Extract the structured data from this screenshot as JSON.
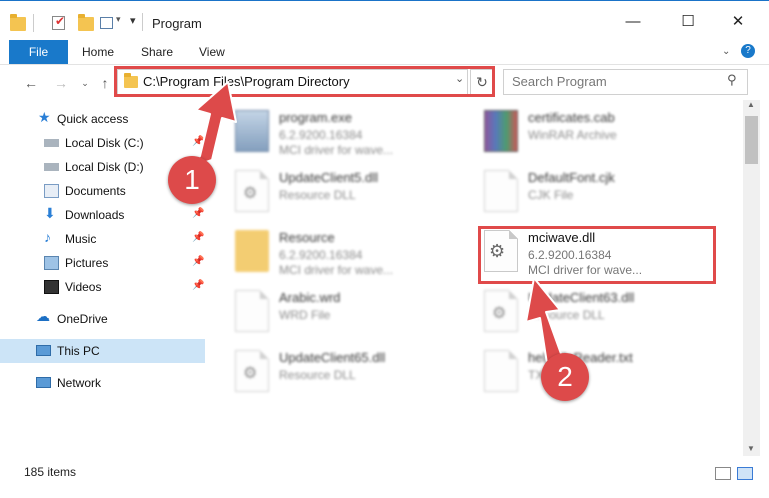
{
  "window": {
    "title": "Program",
    "minimize": "—",
    "maximize": "☐",
    "close": "✕"
  },
  "ribbon": {
    "tabs": [
      "File",
      "Home",
      "Share",
      "View"
    ],
    "help": "?"
  },
  "address": {
    "path": "C:\\Program Files\\Program Directory",
    "search_placeholder": "Search Program"
  },
  "sidebar": {
    "items": [
      {
        "label": "Quick access"
      },
      {
        "label": "Local Disk (C:)"
      },
      {
        "label": "Local Disk (D:)"
      },
      {
        "label": "Documents"
      },
      {
        "label": "Downloads"
      },
      {
        "label": "Music"
      },
      {
        "label": "Pictures"
      },
      {
        "label": "Videos"
      },
      {
        "label": "OneDrive"
      },
      {
        "label": "This PC"
      },
      {
        "label": "Network"
      }
    ]
  },
  "files": [
    {
      "name": "program.exe",
      "line1": "6.2.9200.16384",
      "line2": "MCI driver for wave...",
      "icon": "exe-icon"
    },
    {
      "name": "certificates.cab",
      "line1": "WinRAR Archive",
      "line2": "",
      "icon": "winrar-icon"
    },
    {
      "name": "UpdateClient5.dll",
      "line1": "Resource DLL",
      "line2": "",
      "icon": "dll-icon"
    },
    {
      "name": "DefaultFont.cjk",
      "line1": "CJK File",
      "line2": "",
      "icon": "file-icon"
    },
    {
      "name": "Resource",
      "line1": "6.2.9200.16384",
      "line2": "MCI driver for wave...",
      "icon": "folder-icon"
    },
    {
      "name": "mciwave.dll",
      "line1": "6.2.9200.16384",
      "line2": "MCI driver for wave...",
      "icon": "dll-icon"
    },
    {
      "name": "Arabic.wrd",
      "line1": "WRD File",
      "line2": "",
      "icon": "file-icon"
    },
    {
      "name": "UpdateClient63.dll",
      "line1": "Resource DLL",
      "line2": "",
      "icon": "dll-icon"
    },
    {
      "name": "UpdateClient65.dll",
      "line1": "Resource DLL",
      "line2": "",
      "icon": "dll-icon"
    },
    {
      "name": "helpFileReader.txt",
      "line1": "TXT",
      "line2": "",
      "icon": "file-icon"
    }
  ],
  "status": {
    "count": "185 items"
  },
  "annotations": {
    "badge1": "1",
    "badge2": "2",
    "color": "#dd4a4a"
  }
}
